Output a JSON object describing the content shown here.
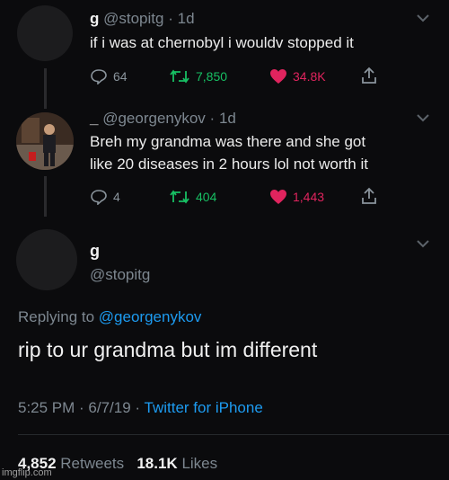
{
  "tweets": [
    {
      "display_name": "g",
      "handle": "@stopitg",
      "time": "1d",
      "text": "if i was at chernobyl i wouldv stopped it",
      "replies": "64",
      "retweets": "7,850",
      "likes": "34.8K"
    },
    {
      "display_name": "_",
      "handle": "@georgenykov",
      "time": "1d",
      "text_line1": "Breh my grandma was there and she got",
      "text_line2": "like 20 diseases in 2 hours lol not worth it",
      "replies": "4",
      "retweets": "404",
      "likes": "1,443"
    }
  ],
  "main_tweet": {
    "display_name": "g",
    "handle": "@stopitg",
    "replying_prefix": "Replying to",
    "replying_to": "@georgenykov",
    "text": "rip to ur grandma but im different",
    "timestamp": "5:25 PM · 6/7/19 ·",
    "source": "Twitter for iPhone",
    "retweets_count": "4,852",
    "retweets_label": "Retweets",
    "likes_count": "18.1K",
    "likes_label": "Likes"
  },
  "watermark": "imgflip.com",
  "colors": {
    "background": "#0b0b0d",
    "link": "#1d9bf0",
    "like": "#e0245e",
    "retweet": "#17bf63",
    "muted": "#7d8790"
  }
}
